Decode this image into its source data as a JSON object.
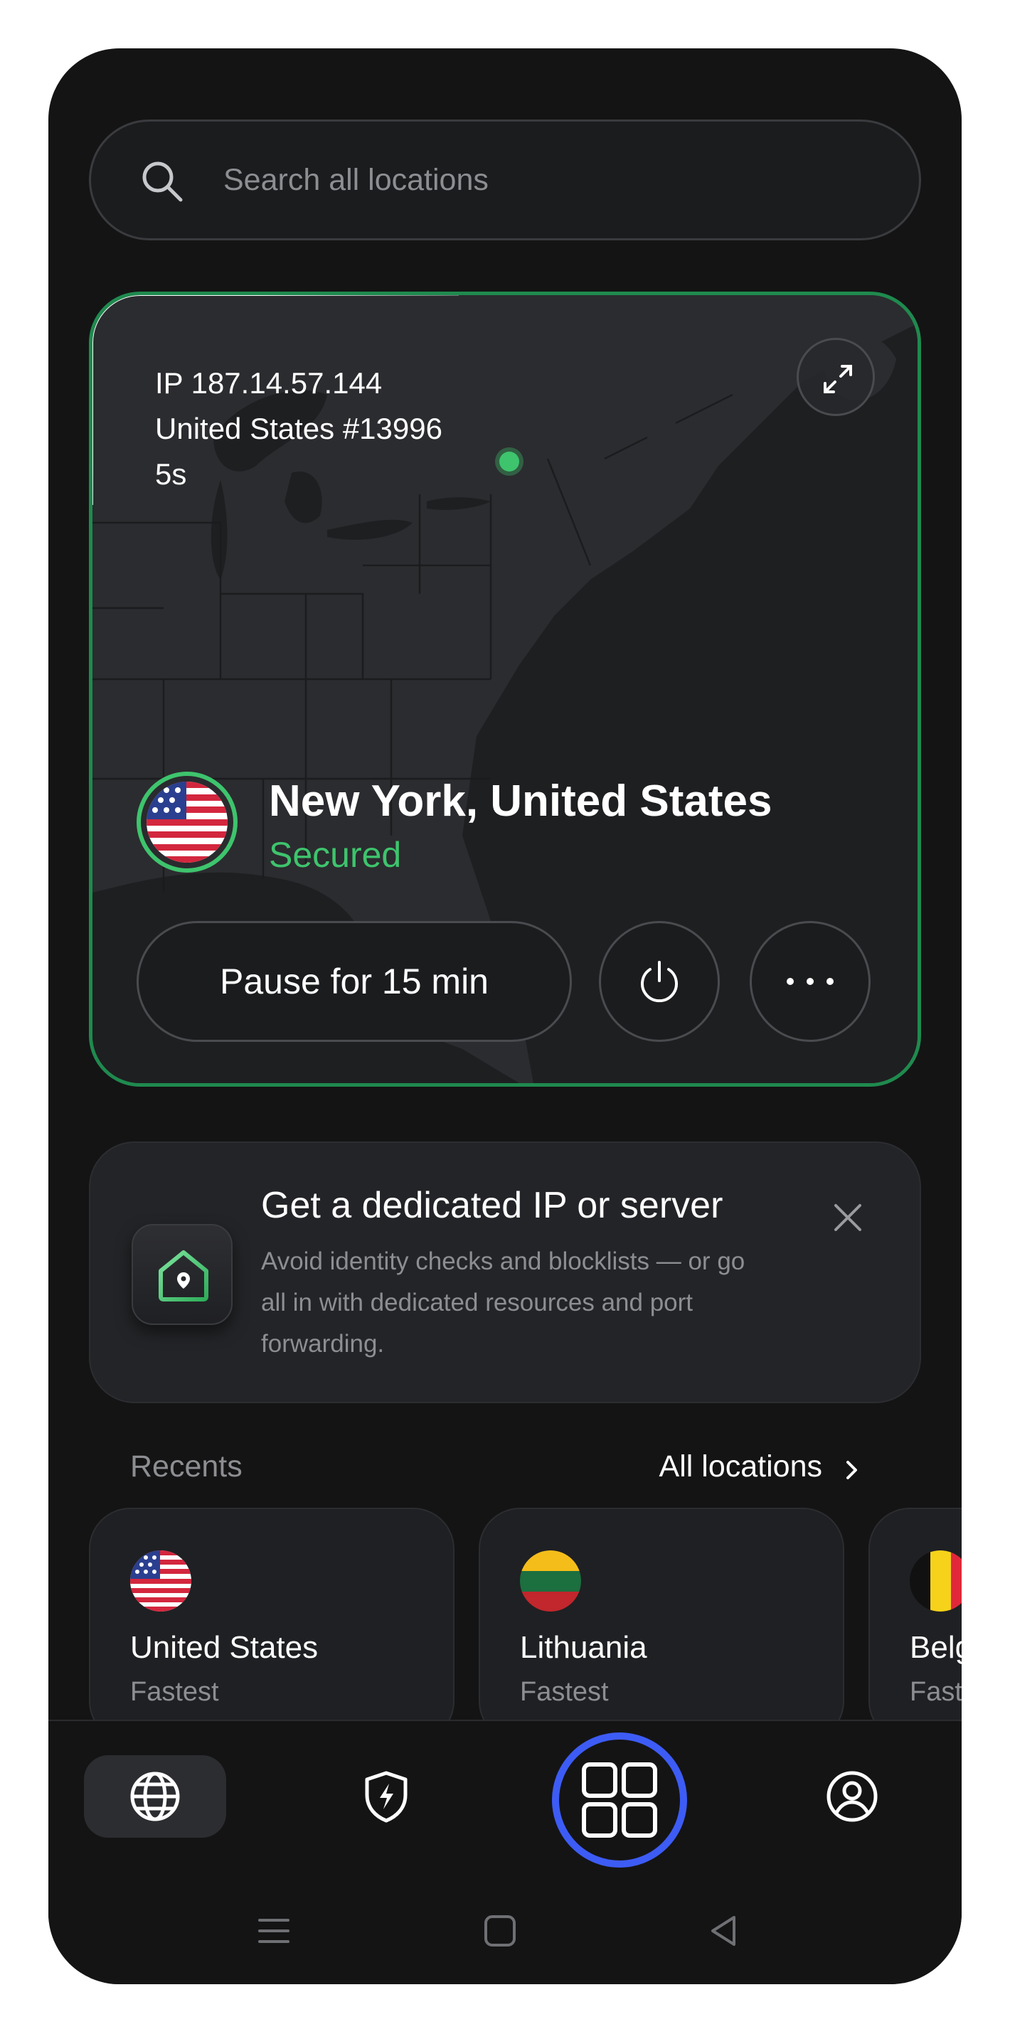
{
  "search": {
    "placeholder": "Search all locations"
  },
  "connection": {
    "ip": "IP 187.14.57.144",
    "server": "United States #13996",
    "duration": "5s",
    "location": "New York, United States",
    "status": "Secured",
    "pause_label": "Pause for 15 min"
  },
  "promo": {
    "title": "Get a dedicated IP or server",
    "body": "Avoid identity checks and blocklists — or go all in with dedicated resources and port forwarding."
  },
  "recents": {
    "label": "Recents",
    "all_locations": "All locations",
    "items": [
      {
        "country": "United States",
        "mode": "Fastest"
      },
      {
        "country": "Lithuania",
        "mode": "Fastest"
      },
      {
        "country": "Belgium",
        "mode": "Fastest"
      }
    ]
  },
  "colors": {
    "accent_green": "#3ec46d",
    "accent_blue": "#3d5cf5",
    "background": "#141415"
  },
  "nav": {
    "items": [
      "globe-icon",
      "shield-bolt-icon",
      "grid-icon",
      "account-icon"
    ],
    "active": "globe-icon"
  }
}
